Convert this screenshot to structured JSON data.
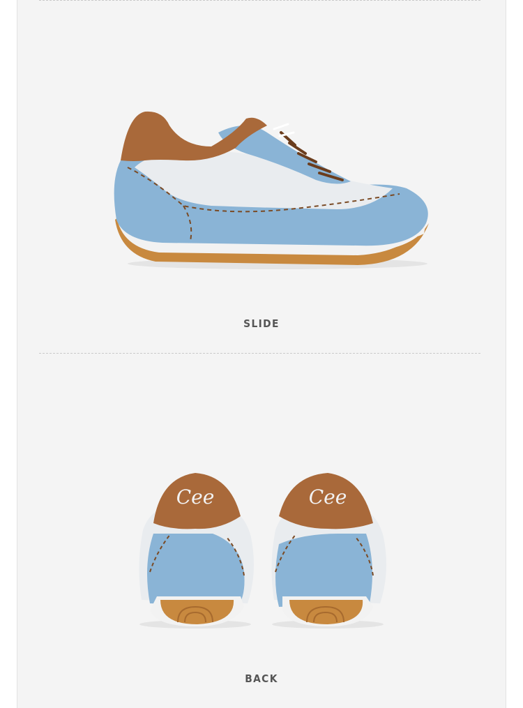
{
  "sections": [
    {
      "caption": "SLIDE",
      "image": "shoe-side-view"
    },
    {
      "caption": "BACK",
      "image": "shoe-back-view"
    }
  ],
  "heel_logo": {
    "text": "Cee"
  },
  "colors": {
    "background": "#f4f4f4",
    "suede_blue": "#8ab4d6",
    "leather_brown": "#a9693a",
    "white_panel": "#e9ecef",
    "gum_sole": "#c8893f",
    "stitch": "#7a4a24"
  }
}
